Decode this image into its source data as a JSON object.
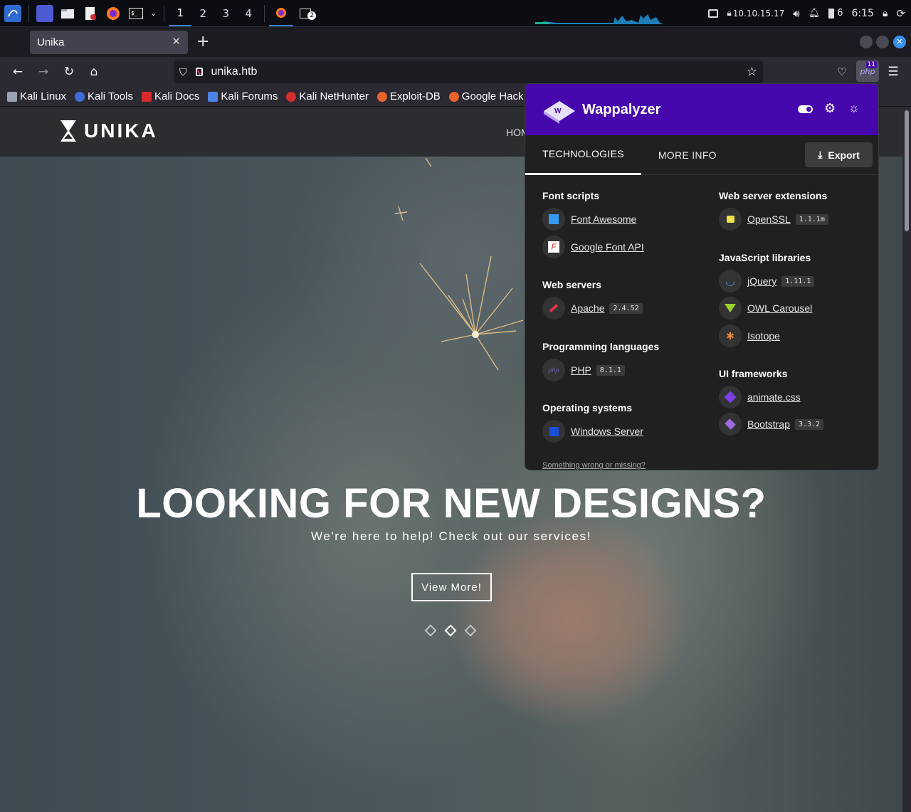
{
  "taskbar": {
    "workspaces": [
      "1",
      "2",
      "3",
      "4"
    ],
    "active_workspace": "1",
    "terminal_badge": "2",
    "ip": "10.10.15.17",
    "battery": "6",
    "time": "6:15"
  },
  "browser": {
    "tab_title": "Unika",
    "url": "unika.htb",
    "extension_badge": "11",
    "bookmarks": [
      "Kali Linux",
      "Kali Tools",
      "Kali Docs",
      "Kali Forums",
      "Kali NetHunter",
      "Exploit-DB",
      "Google Hack"
    ]
  },
  "site": {
    "logo": "UNIKA",
    "nav_first": "HOM",
    "hero_title": "LOOKING FOR NEW DESIGNS?",
    "hero_subtitle": "We're here to help! Check out our services!",
    "hero_button": "View More!"
  },
  "wappalyzer": {
    "brand": "Wappalyzer",
    "tabs": [
      "TECHNOLOGIES",
      "MORE INFO"
    ],
    "export": "Export",
    "left": [
      {
        "category": "Font scripts",
        "items": [
          {
            "name": "Font Awesome",
            "version": "",
            "icon": "font-awesome-icon"
          },
          {
            "name": "Google Font API",
            "version": "",
            "icon": "google-font-icon"
          }
        ]
      },
      {
        "category": "Web servers",
        "items": [
          {
            "name": "Apache",
            "version": "2.4.52",
            "icon": "apache-feather-icon"
          }
        ]
      },
      {
        "category": "Programming languages",
        "items": [
          {
            "name": "PHP",
            "version": "8.1.1",
            "icon": "php-icon"
          }
        ]
      },
      {
        "category": "Operating systems",
        "items": [
          {
            "name": "Windows Server",
            "version": "",
            "icon": "windows-icon"
          }
        ]
      }
    ],
    "right": [
      {
        "category": "Web server extensions",
        "items": [
          {
            "name": "OpenSSL",
            "version": "1.1.1m",
            "icon": "lock-icon"
          }
        ]
      },
      {
        "category": "JavaScript libraries",
        "items": [
          {
            "name": "jQuery",
            "version": "1.11.1",
            "icon": "jquery-icon"
          },
          {
            "name": "OWL Carousel",
            "version": "",
            "icon": "owl-icon"
          },
          {
            "name": "Isotope",
            "version": "",
            "icon": "isotope-icon"
          }
        ]
      },
      {
        "category": "UI frameworks",
        "items": [
          {
            "name": "animate.css",
            "version": "",
            "icon": "animate-icon"
          },
          {
            "name": "Bootstrap",
            "version": "3.3.2",
            "icon": "bootstrap-icon"
          }
        ]
      }
    ],
    "footer": "Something wrong or missing?"
  }
}
